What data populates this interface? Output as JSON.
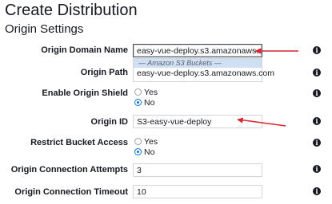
{
  "page": {
    "title": "Create Distribution",
    "section_title": "Origin Settings"
  },
  "fields": {
    "origin_domain_name": {
      "label": "Origin Domain Name",
      "value": "easy-vue-deploy.s3.amazonaws.com",
      "dropdown": {
        "group_header": "— Amazon S3 Buckets —",
        "items": [
          "easy-vue-deploy.s3.amazonaws.com"
        ]
      }
    },
    "origin_path": {
      "label": "Origin Path",
      "value": ""
    },
    "enable_origin_shield": {
      "label": "Enable Origin Shield",
      "options": [
        "Yes",
        "No"
      ],
      "selected": "No"
    },
    "origin_id": {
      "label": "Origin ID",
      "value": "S3-easy-vue-deploy"
    },
    "restrict_bucket_access": {
      "label": "Restrict Bucket Access",
      "options": [
        "Yes",
        "No"
      ],
      "selected": "No"
    },
    "origin_connection_attempts": {
      "label": "Origin Connection Attempts",
      "value": "3"
    },
    "origin_connection_timeout": {
      "label": "Origin Connection Timeout",
      "value": "10"
    }
  },
  "info_icon_glyph": "i",
  "annotation_color": "#d9232d"
}
